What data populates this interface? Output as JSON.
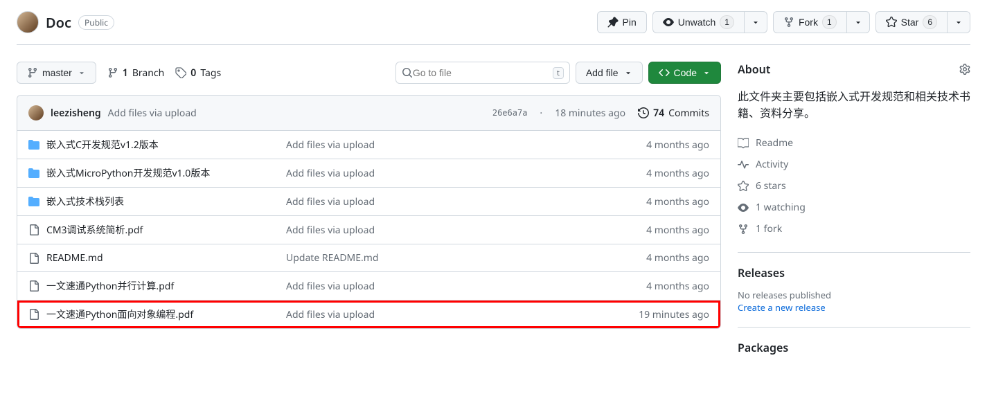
{
  "repo": {
    "name": "Doc",
    "visibility": "Public"
  },
  "actions": {
    "pin": "Pin",
    "watch": {
      "label": "Unwatch",
      "count": "1"
    },
    "fork": {
      "label": "Fork",
      "count": "1"
    },
    "star": {
      "label": "Star",
      "count": "6"
    }
  },
  "branchBtn": {
    "label": "master"
  },
  "meta": {
    "branches_count": "1",
    "branches_label": "Branch",
    "tags_count": "0",
    "tags_label": "Tags"
  },
  "search": {
    "placeholder": "Go to file",
    "kbd": "t"
  },
  "addfile": "Add file",
  "codebtn": "Code",
  "latest": {
    "author": "leezisheng",
    "msg": "Add files via upload",
    "sha": "26e6a7a",
    "ago": "18 minutes ago",
    "commits_count": "74",
    "commits_label": "Commits"
  },
  "files": [
    {
      "type": "dir",
      "name": "嵌入式C开发规范v1.2版本",
      "msg": "Add files via upload",
      "age": "4 months ago"
    },
    {
      "type": "dir",
      "name": "嵌入式MicroPython开发规范v1.0版本",
      "msg": "Add files via upload",
      "age": "4 months ago"
    },
    {
      "type": "dir",
      "name": "嵌入式技术栈列表",
      "msg": "Add files via upload",
      "age": "4 months ago"
    },
    {
      "type": "file",
      "name": "CM3调试系统简析.pdf",
      "msg": "Add files via upload",
      "age": "4 months ago"
    },
    {
      "type": "file",
      "name": "README.md",
      "msg": "Update README.md",
      "age": "4 months ago"
    },
    {
      "type": "file",
      "name": "一文速通Python并行计算.pdf",
      "msg": "Add files via upload",
      "age": "4 months ago"
    },
    {
      "type": "file",
      "name": "一文速通Python面向对象编程.pdf",
      "msg": "Add files via upload",
      "age": "19 minutes ago",
      "highlight": true
    }
  ],
  "about": {
    "title": "About",
    "description": "此文件夹主要包括嵌入式开发规范和相关技术书籍、资料分享。",
    "links": {
      "readme": "Readme",
      "activity": "Activity",
      "stars": "6 stars",
      "watching": "1 watching",
      "forks": "1 fork"
    }
  },
  "releases": {
    "title": "Releases",
    "empty": "No releases published",
    "create": "Create a new release"
  },
  "packages": {
    "title": "Packages"
  }
}
